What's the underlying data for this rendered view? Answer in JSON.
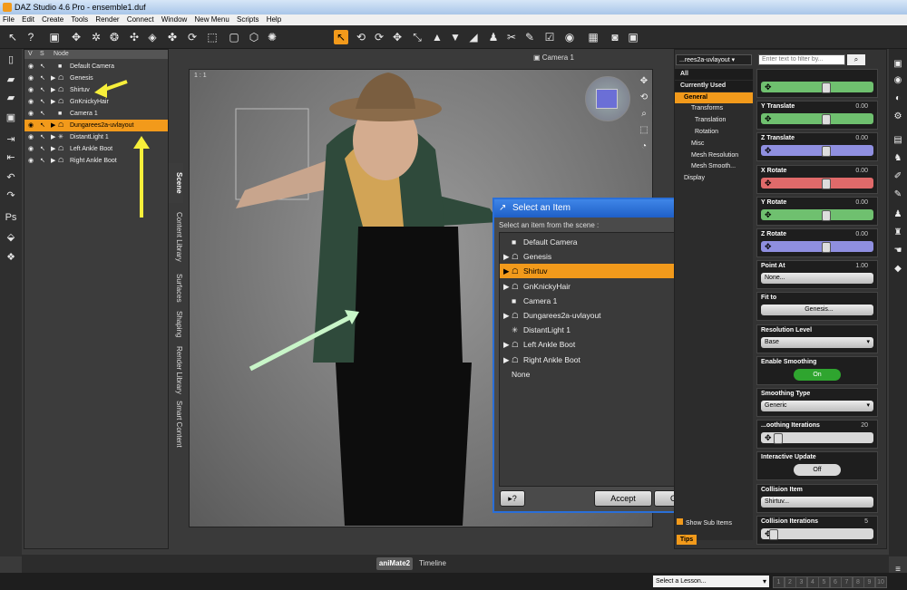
{
  "app": {
    "title": "DAZ Studio 4.6 Pro - ensemble1.duf"
  },
  "menu": [
    "File",
    "Edit",
    "Create",
    "Tools",
    "Render",
    "Connect",
    "Window",
    "New Menu",
    "Scripts",
    "Help"
  ],
  "scene_panel": {
    "columns": {
      "v": "V",
      "s": "S",
      "node": "Node"
    },
    "nodes": [
      {
        "label": "Default Camera",
        "icon": "camera-icon",
        "arrow": ""
      },
      {
        "label": "Genesis",
        "icon": "figure-icon",
        "arrow": "▶"
      },
      {
        "label": "Shirtuv",
        "icon": "figure-icon",
        "arrow": "▶"
      },
      {
        "label": "GnKnickyHair",
        "icon": "figure-icon",
        "arrow": "▶"
      },
      {
        "label": "Camera 1",
        "icon": "camera-icon",
        "arrow": ""
      },
      {
        "label": "Dungarees2a-uvlayout",
        "icon": "figure-icon",
        "arrow": "▶",
        "selected": true
      },
      {
        "label": "DistantLight 1",
        "icon": "light-icon",
        "arrow": "▶"
      },
      {
        "label": "Left Ankle Boot",
        "icon": "figure-icon",
        "arrow": "▶"
      },
      {
        "label": "Right Ankle Boot",
        "icon": "figure-icon",
        "arrow": "▶"
      }
    ]
  },
  "side_tabs": [
    "Scene",
    "Content Library",
    "Surfaces",
    "Shaping",
    "Render Library",
    "Smart Content"
  ],
  "viewport": {
    "camera": "Camera 1",
    "ratio": "1 : 1"
  },
  "dialog": {
    "title": "Select an Item",
    "instruction": "Select an item from the scene :",
    "items": [
      {
        "label": "Default Camera",
        "icon": "camera-icon",
        "arrow": ""
      },
      {
        "label": "Genesis",
        "icon": "figure-icon",
        "arrow": "▶"
      },
      {
        "label": "Shirtuv",
        "icon": "figure-icon",
        "arrow": "▶",
        "selected": true
      },
      {
        "label": "GnKnickyHair",
        "icon": "figure-icon",
        "arrow": "▶"
      },
      {
        "label": "Camera 1",
        "icon": "camera-icon",
        "arrow": ""
      },
      {
        "label": "Dungarees2a-uvlayout",
        "icon": "figure-icon",
        "arrow": "▶"
      },
      {
        "label": "DistantLight 1",
        "icon": "light-icon",
        "arrow": ""
      },
      {
        "label": "Left Ankle Boot",
        "icon": "figure-icon",
        "arrow": "▶"
      },
      {
        "label": "Right Ankle Boot",
        "icon": "figure-icon",
        "arrow": "▶"
      },
      {
        "label": "None",
        "icon": "",
        "arrow": ""
      }
    ],
    "help": "?",
    "accept": "Accept",
    "cancel": "Cancel"
  },
  "parameters": {
    "node_select": "...rees2a-uvlayout",
    "filter_placeholder": "Enter text to filter by...",
    "groups": [
      {
        "label": "All",
        "kind": "hdr"
      },
      {
        "label": "Currently Used",
        "kind": "hdr"
      },
      {
        "label": "General",
        "kind": "sel"
      },
      {
        "label": "Transforms",
        "kind": "sub"
      },
      {
        "label": "Translation",
        "kind": "subsub"
      },
      {
        "label": "Rotation",
        "kind": "subsub"
      },
      {
        "label": "Misc",
        "kind": "sub"
      },
      {
        "label": "Mesh Resolution",
        "kind": "sub"
      },
      {
        "label": "Mesh Smooth...",
        "kind": "sub"
      },
      {
        "label": "Display",
        "kind": "grp"
      }
    ],
    "show_sub_items": "Show Sub Items",
    "tips": "Tips",
    "props": [
      {
        "label": "",
        "type": "slider",
        "color": "#6fc06f",
        "knob": 0.58
      },
      {
        "label": "Y Translate",
        "value": "0.00",
        "type": "slider",
        "color": "#6fc06f",
        "knob": 0.58
      },
      {
        "label": "Z Translate",
        "value": "0.00",
        "type": "slider",
        "color": "#8f8fe0",
        "knob": 0.58
      },
      {
        "label": "X Rotate",
        "value": "0.00",
        "type": "slider",
        "color": "#e06a6a",
        "knob": 0.58
      },
      {
        "label": "Y Rotate",
        "value": "0.00",
        "type": "slider",
        "color": "#6fc06f",
        "knob": 0.58
      },
      {
        "label": "Z Rotate",
        "value": "0.00",
        "type": "slider",
        "color": "#8f8fe0",
        "knob": 0.58
      },
      {
        "label": "Point At",
        "value": "1.00",
        "type": "button",
        "button": "None..."
      },
      {
        "label": "Fit to",
        "type": "button",
        "button": "Genesis...",
        "center": true
      },
      {
        "label": "Resolution Level",
        "type": "select",
        "button": "Base"
      },
      {
        "label": "Enable Smoothing",
        "type": "toggle",
        "button": "On",
        "on": true
      },
      {
        "label": "Smoothing Type",
        "type": "select",
        "button": "Generic"
      },
      {
        "label": "...oothing Iterations",
        "value": "20",
        "type": "slider",
        "color": "#d8d8d8",
        "knob": 0.12
      },
      {
        "label": "Interactive Update",
        "type": "toggle",
        "button": "Off",
        "on": false
      },
      {
        "label": "Collision Item",
        "type": "button",
        "button": "Shirtuv..."
      },
      {
        "label": "Collision Iterations",
        "value": "5",
        "type": "slider",
        "color": "#d8d8d8",
        "knob": 0.08
      }
    ]
  },
  "bottom": {
    "tab1": "aniMate2",
    "tab2": "Timeline"
  },
  "status": {
    "lesson": "Select a Lesson...",
    "pages": [
      "1",
      "2",
      "3",
      "4",
      "5",
      "6",
      "7",
      "8",
      "9",
      "10"
    ]
  }
}
